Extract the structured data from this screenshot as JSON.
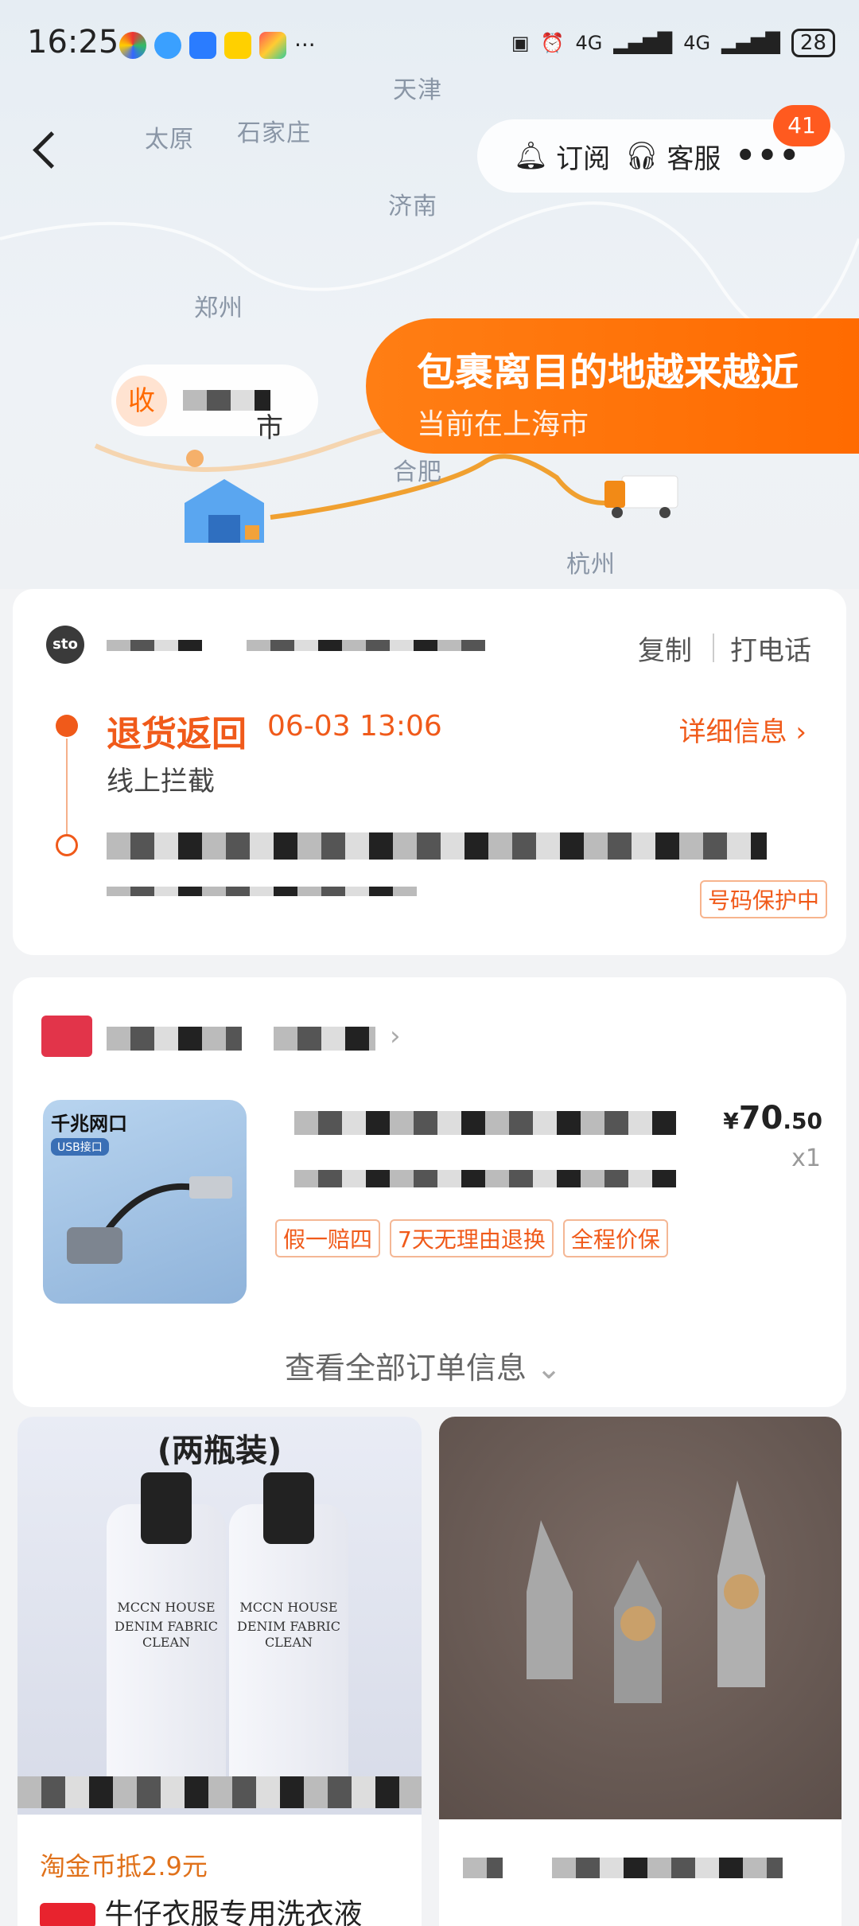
{
  "status_bar": {
    "time": "16:25",
    "more": "···",
    "net1": "4G",
    "net2": "4G",
    "battery": "28"
  },
  "map": {
    "cities": [
      "天津",
      "太原",
      "石家庄",
      "济南",
      "郑州",
      "合肥",
      "杭州",
      "市"
    ],
    "receive_label": "收",
    "banner_title": "包裹离目的地越来越近",
    "banner_sub": "当前在上海市"
  },
  "toolbar": {
    "subscribe": "订阅",
    "service": "客服",
    "badge": "41"
  },
  "logistics": {
    "carrier_logo": "sto",
    "copy": "复制",
    "call": "打电话",
    "status": "退货返回",
    "time": "06-03 13:06",
    "detail": "详细信息",
    "sub": "线上拦截",
    "protect": "号码保护中"
  },
  "order": {
    "price_symbol": "¥",
    "price_int": "70",
    "price_dec": ".50",
    "qty": "x1",
    "tags": [
      "假一赔四",
      "7天无理由退换",
      "全程价保"
    ],
    "image_title": "千兆网口",
    "image_badge": "USB接口",
    "view_all": "查看全部订单信息"
  },
  "recommend": {
    "item1_banner": "(两瓶装)",
    "item1_label1": "MCCN HOUSE",
    "item1_label2": "DENIM FABRIC CLEAN",
    "item1_coin": "淘金币抵2.9元",
    "item1_title": "牛仔衣服专用洗衣液"
  }
}
